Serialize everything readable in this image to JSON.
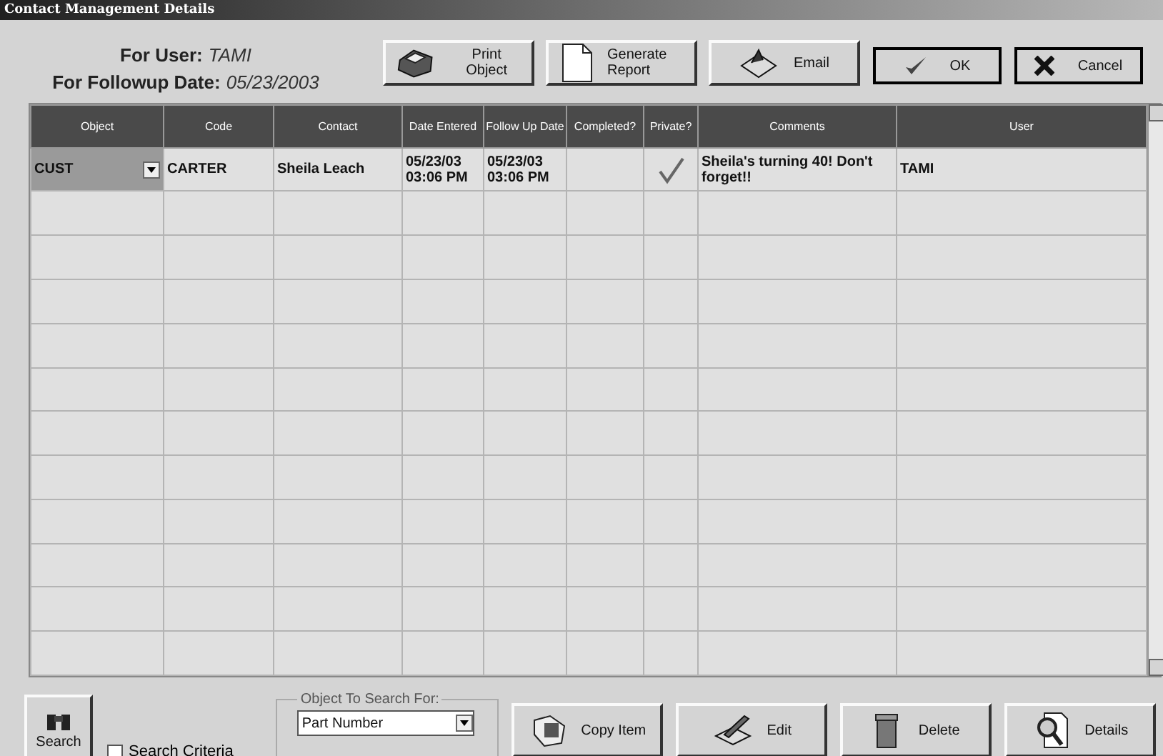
{
  "window": {
    "title": "Contact Management Details"
  },
  "header": {
    "user_label": "For User:",
    "user_value": "TAMI",
    "date_label": "For Followup Date:",
    "date_value": "05/23/2003"
  },
  "top_buttons": [
    {
      "kind": "print",
      "label": "Print Object"
    },
    {
      "kind": "report",
      "label": "Generate Report"
    },
    {
      "kind": "email",
      "label": "Email"
    },
    {
      "kind": "ok",
      "label": "OK"
    },
    {
      "kind": "cancel",
      "label": "Cancel"
    }
  ],
  "table": {
    "columns": [
      "Object",
      "Code",
      "Contact",
      "Date Entered",
      "Follow Up Date",
      "Completed?",
      "Private?",
      "Comments",
      "User"
    ],
    "rows": [
      {
        "selected": true,
        "object": "CUST",
        "code": "CARTER",
        "contact": "Sheila Leach",
        "date_entered": "05/23/03 03:06 PM",
        "follow_up": "05/23/03 03:06 PM",
        "completed": false,
        "private": true,
        "comments": "Sheila's turning 40! Don't forget!!",
        "user": "TAMI"
      }
    ]
  },
  "search": {
    "label": "Search",
    "criteria": {
      "label": "Search Criteria",
      "checked": false
    }
  },
  "object_search": {
    "legend": "Object To Search For:",
    "value": "Part Number"
  },
  "bottom_buttons": [
    {
      "kind": "copy",
      "label": "Copy Item"
    },
    {
      "kind": "edit",
      "label": "Edit"
    },
    {
      "kind": "delete",
      "label": "Delete"
    },
    {
      "kind": "details",
      "label": "Details"
    }
  ]
}
